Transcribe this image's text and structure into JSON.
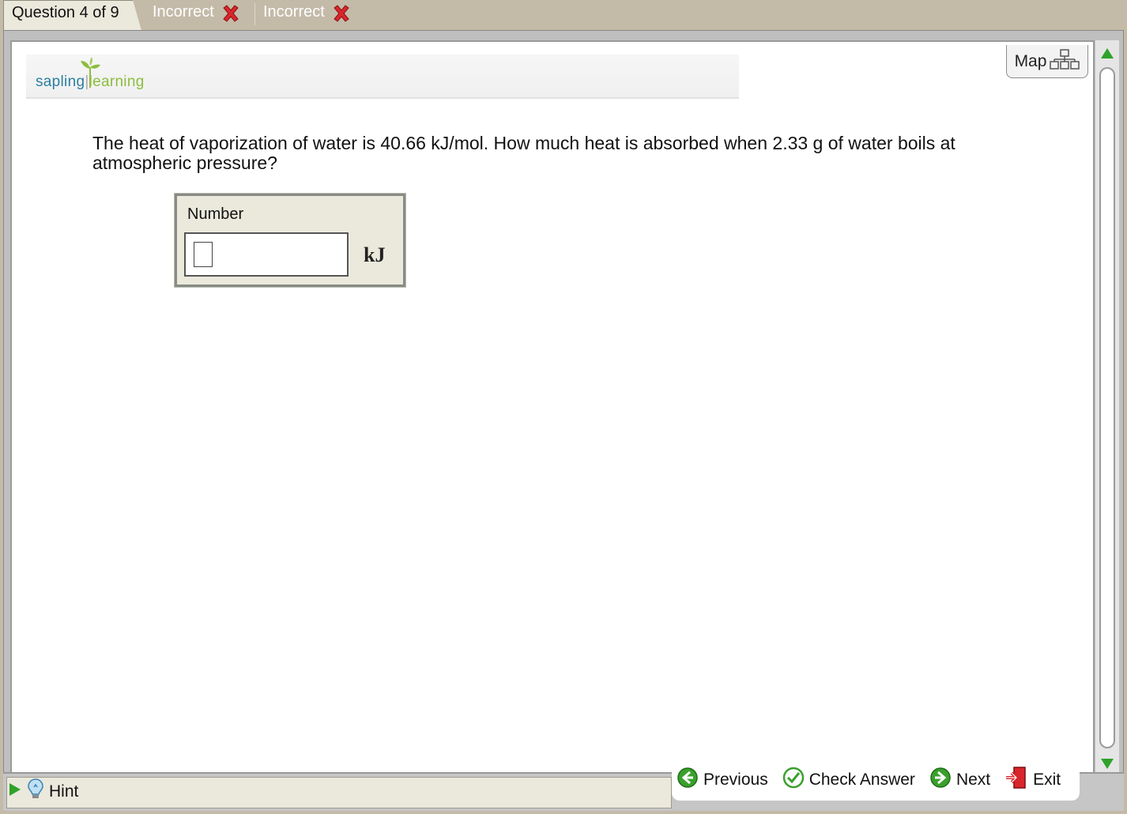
{
  "tabs": {
    "active": "Question 4 of 9",
    "attempts": [
      {
        "label": "Incorrect",
        "icon": "red-x-icon"
      },
      {
        "label": "Incorrect",
        "icon": "red-x-icon"
      }
    ]
  },
  "logo": {
    "sapling": "sapling",
    "learning": "learning"
  },
  "map": {
    "label": "Map",
    "icon": "sitemap-icon"
  },
  "question": {
    "text": "The heat of vaporization of water is 40.66 kJ/mol. How much heat is absorbed when 2.33 g of water boils at atmospheric pressure?"
  },
  "answer": {
    "label": "Number",
    "value": "",
    "unit": "kJ"
  },
  "hint": {
    "label": "Hint"
  },
  "nav": {
    "previous": "Previous",
    "check": "Check Answer",
    "next": "Next",
    "exit": "Exit"
  },
  "colors": {
    "accent_green": "#3aa02c",
    "incorrect_red": "#d9262c",
    "chrome": "#c4baa8"
  }
}
